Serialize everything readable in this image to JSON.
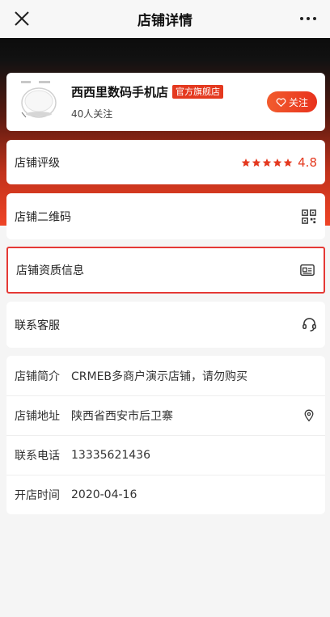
{
  "topbar": {
    "title": "店铺详情",
    "close_icon": "close-icon",
    "more_icon": "more-dots-icon"
  },
  "store": {
    "name": "西西里数码手机店",
    "badge": "官方旗舰店",
    "followers": "40人关注",
    "follow_label": "关注",
    "follow_icon": "heart-icon"
  },
  "rating": {
    "label": "店铺评级",
    "stars": 5,
    "value": "4.8"
  },
  "menu": {
    "qr_label": "店铺二维码",
    "cert_label": "店铺资质信息",
    "service_label": "联系客服"
  },
  "info": {
    "intro_key": "店铺简介",
    "intro_val": "CRMEB多商户演示店铺，请勿购买",
    "address_key": "店铺地址",
    "address_val": "陕西省西安市后卫寨",
    "phone_key": "联系电话",
    "phone_val": "13335621436",
    "opened_key": "开店时间",
    "opened_val": "2020-04-16"
  },
  "colors": {
    "accent": "#e4391f",
    "highlight_border": "#e53935"
  }
}
